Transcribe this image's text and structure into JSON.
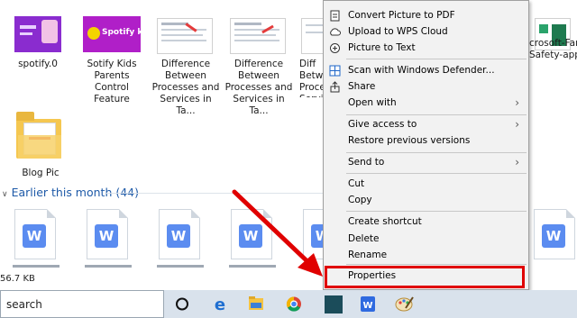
{
  "explorer": {
    "top_row": [
      {
        "caption": "spotify.0"
      },
      {
        "caption": "Sotify Kids Parents Control Feature",
        "logo_text": "Spotify kids"
      },
      {
        "caption": "Difference Between Processes and Services in Ta..."
      },
      {
        "caption": "Difference Between Processes and Services in Ta..."
      },
      {
        "caption": "Diff Betw Proce Servi"
      },
      {
        "caption": "crosoft-Fam Safety-app"
      }
    ],
    "folder": {
      "caption": "Blog Pic"
    },
    "group_header": "Earlier this month (44)",
    "bottom_row_badge": "W",
    "bottom_row_count": 6,
    "status_text": "56.7 KB"
  },
  "context_menu": {
    "items": [
      {
        "label": "Convert Picture to PDF",
        "icon": "pdf-icon"
      },
      {
        "label": "Upload to WPS Cloud",
        "icon": "cloud-icon"
      },
      {
        "label": "Picture to Text",
        "icon": "text-icon"
      },
      {
        "label": "Scan with Windows Defender...",
        "icon": "defender-icon"
      },
      {
        "label": "Share",
        "icon": "share-icon"
      },
      {
        "label": "Open with",
        "submenu": true
      },
      {
        "label": "Give access to",
        "submenu": true
      },
      {
        "label": "Restore previous versions"
      },
      {
        "label": "Send to",
        "submenu": true
      },
      {
        "label": "Cut"
      },
      {
        "label": "Copy"
      },
      {
        "label": "Create shortcut"
      },
      {
        "label": "Delete"
      },
      {
        "label": "Rename"
      },
      {
        "label": "Properties",
        "highlighted": true
      }
    ],
    "highlight_color": "#e00000"
  },
  "taskbar": {
    "search_label": "search",
    "apps": [
      "cortana-icon",
      "edge-icon",
      "file-explorer-icon",
      "chrome-icon",
      "app-icon",
      "wps-icon",
      "paint-icon"
    ]
  }
}
